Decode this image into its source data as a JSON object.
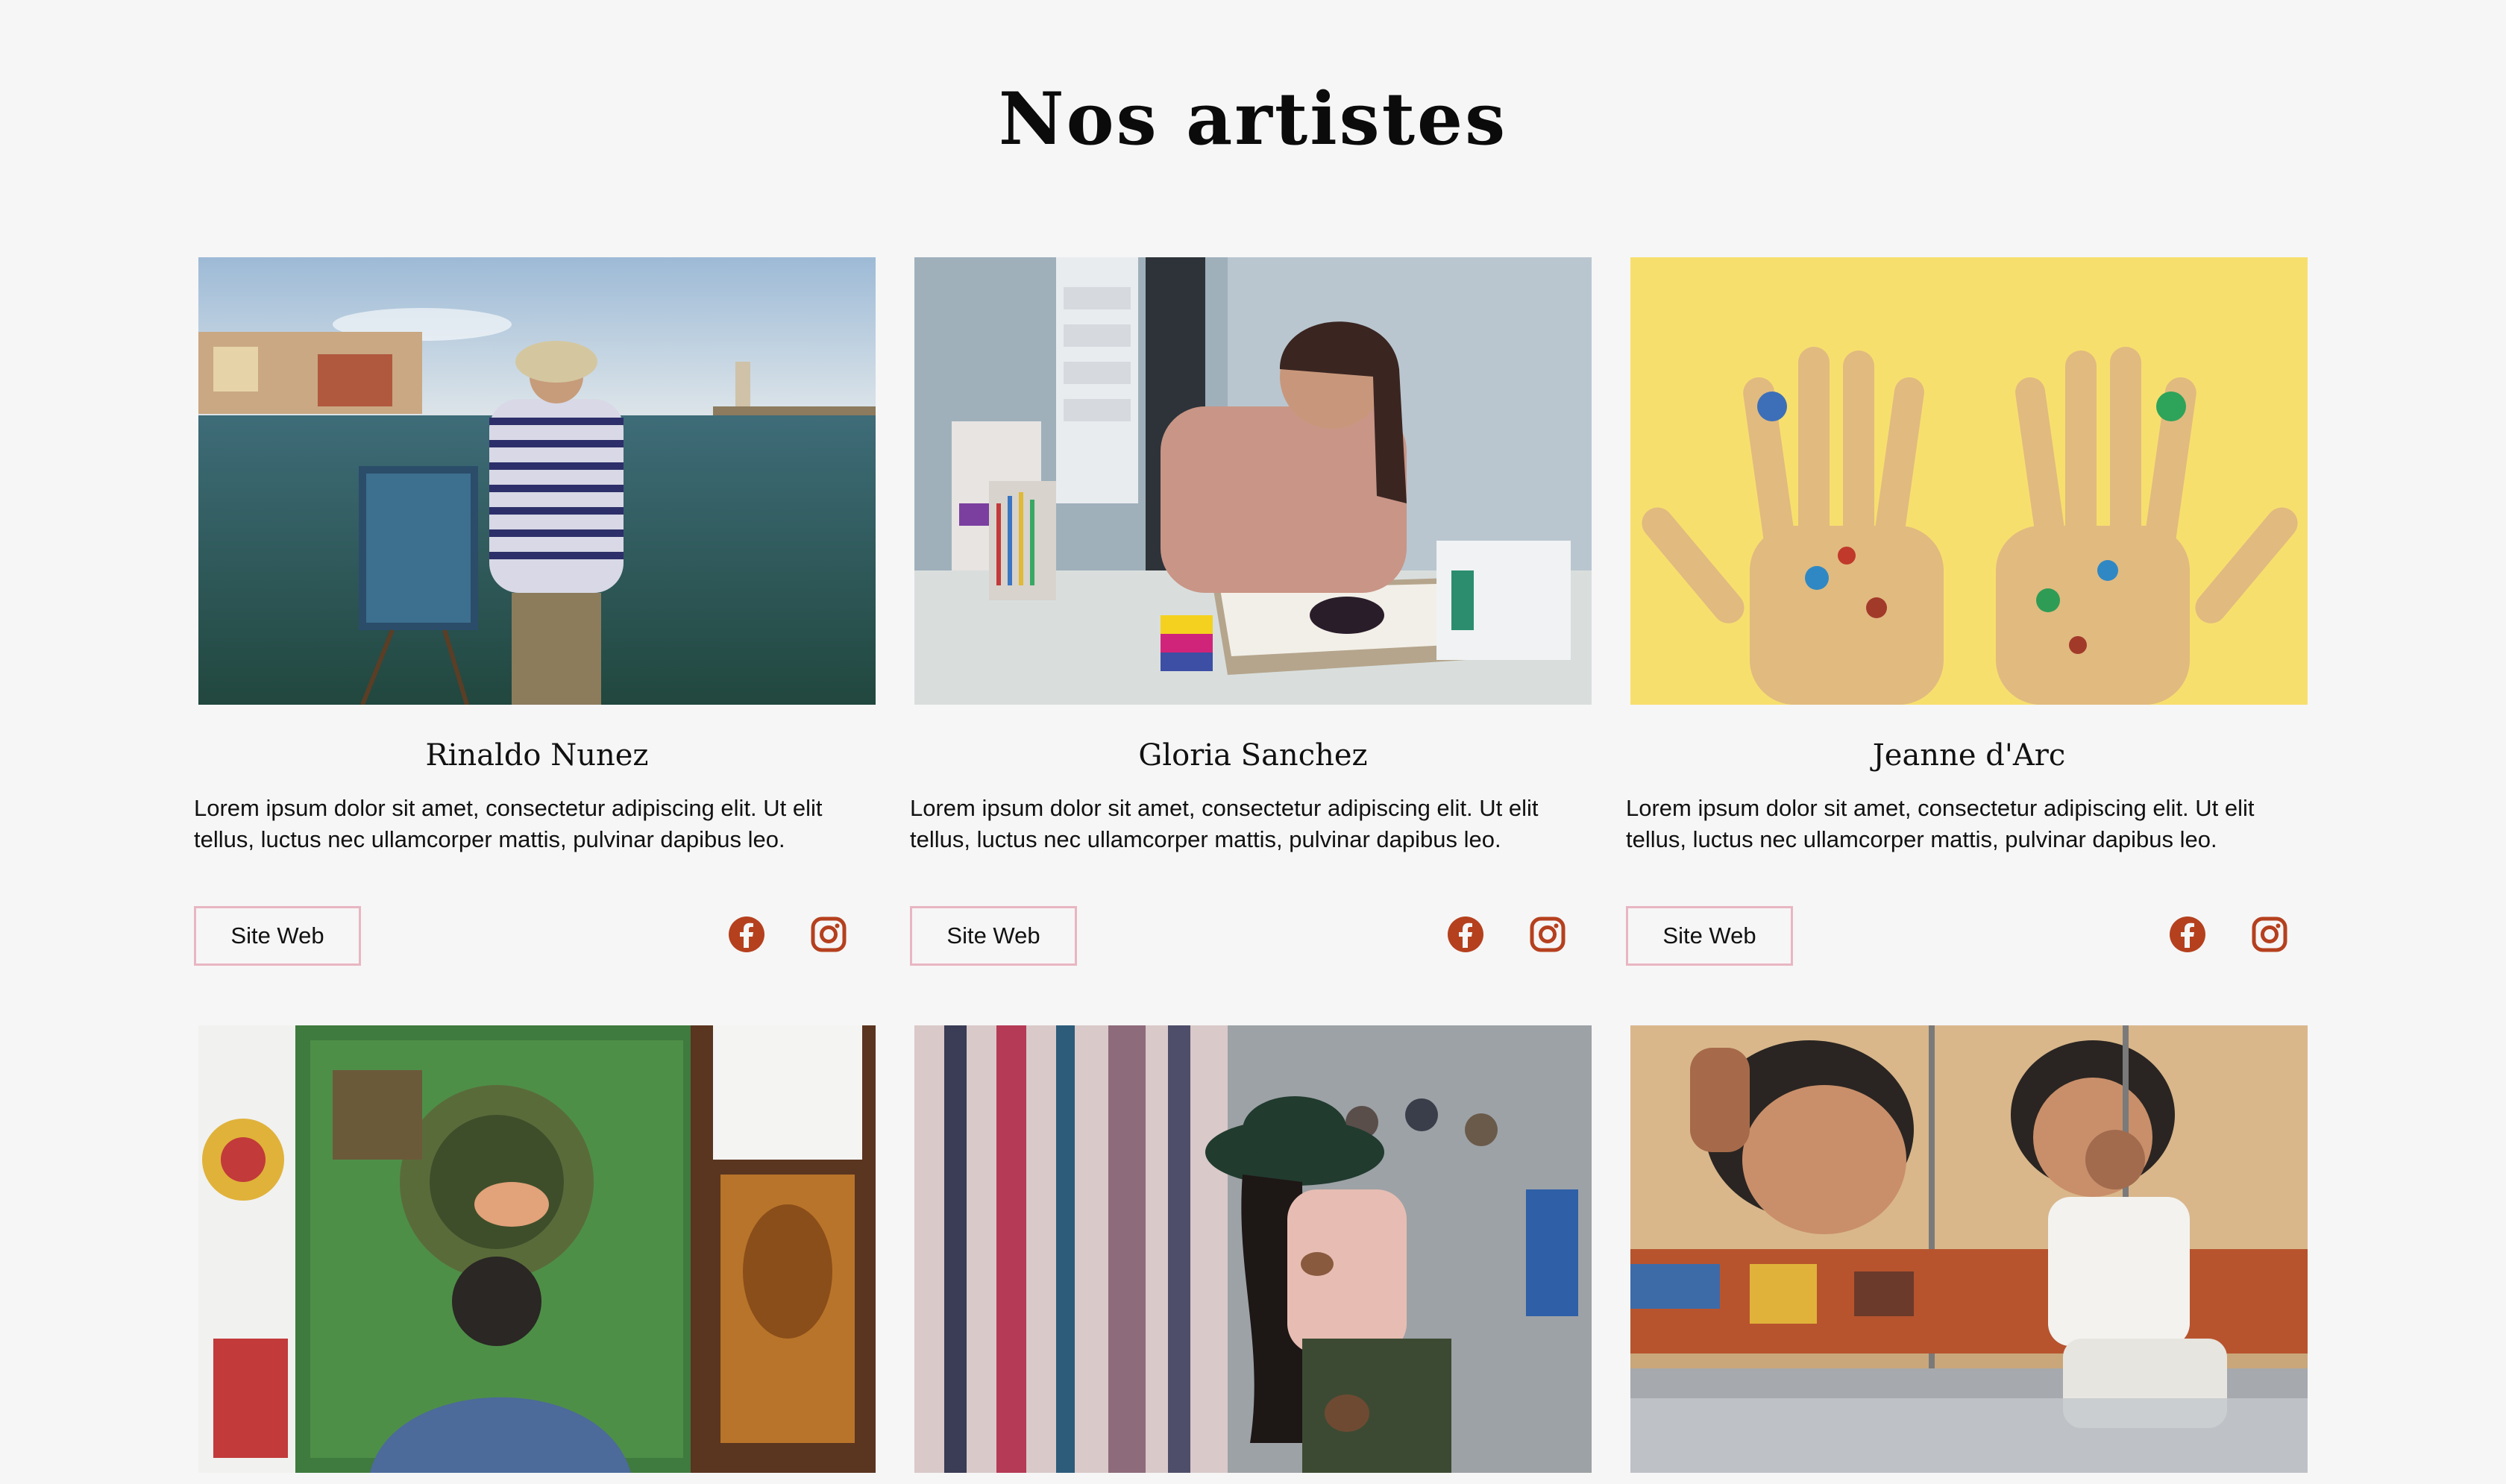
{
  "section": {
    "title": "Nos artistes"
  },
  "artists": [
    {
      "name": "Rinaldo Nunez",
      "description": "Lorem ipsum dolor sit amet, consectetur adipiscing elit. Ut elit tellus, luctus nec ullamcorper mattis, pulvinar dapibus leo.",
      "button_label": "Site Web",
      "icons": [
        "facebook-icon",
        "instagram-icon"
      ]
    },
    {
      "name": "Gloria Sanchez",
      "description": "Lorem ipsum dolor sit amet, consectetur adipiscing elit. Ut elit tellus, luctus nec ullamcorper mattis, pulvinar dapibus leo.",
      "button_label": "Site Web",
      "icons": [
        "facebook-icon",
        "instagram-icon"
      ]
    },
    {
      "name": "Jeanne d'Arc",
      "description": "Lorem ipsum dolor sit amet, consectetur adipiscing elit. Ut elit tellus, luctus nec ullamcorper mattis, pulvinar dapibus leo.",
      "button_label": "Site Web",
      "icons": [
        "facebook-icon",
        "instagram-icon"
      ]
    }
  ],
  "colors": {
    "background": "#f6f6f6",
    "icon_accent": "#b5401e",
    "button_border": "#e8b6c2"
  }
}
